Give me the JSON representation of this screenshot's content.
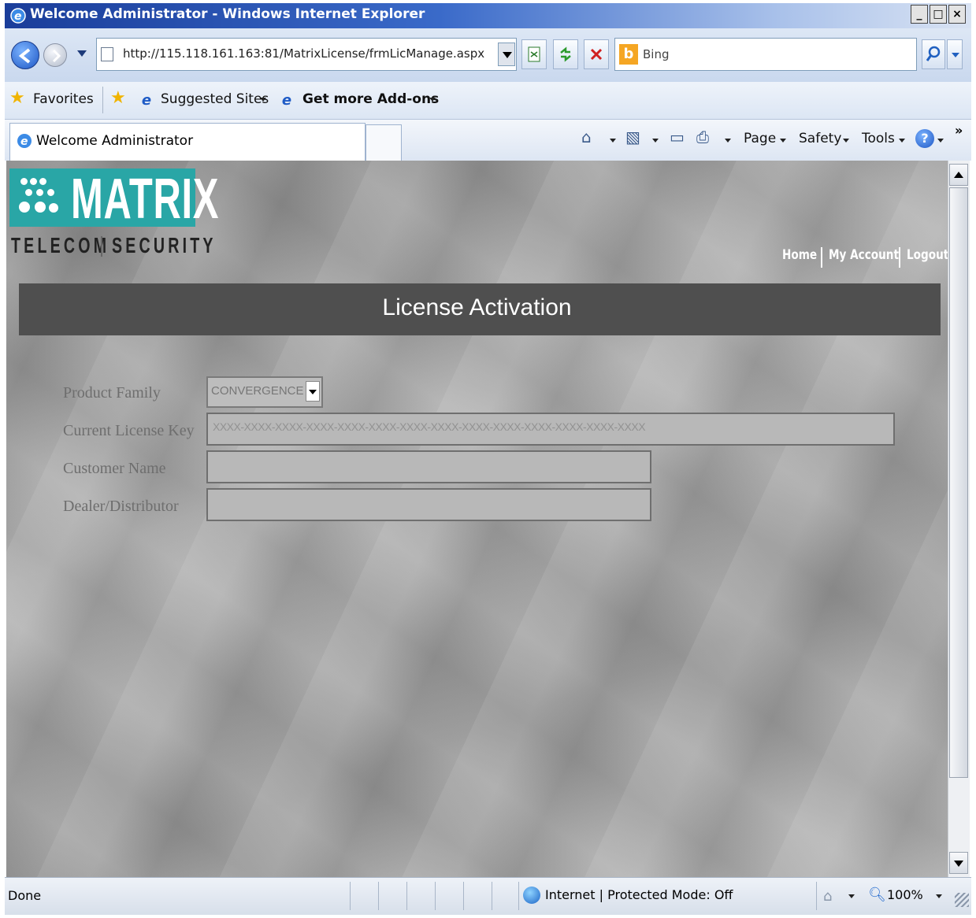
{
  "window": {
    "title": "Welcome Administrator - Windows Internet Explorer",
    "minimize": "_",
    "maximize": "□",
    "close": "×"
  },
  "addressbar": {
    "url": "http://115.118.161.163:81/MatrixLicense/frmLicManage.aspx"
  },
  "search": {
    "provider_icon": "b",
    "placeholder": "Bing",
    "button_glyph": "⚲"
  },
  "favorites_bar": {
    "favorites_label": "Favorites",
    "suggested_sites": "Suggested Sites",
    "get_addons": "Get more Add-ons"
  },
  "tab": {
    "label": "Welcome Administrator"
  },
  "command_bar": {
    "page": "Page",
    "safety": "Safety",
    "tools": "Tools",
    "help": "?",
    "chevron": "»"
  },
  "page": {
    "logo": {
      "name": "MATRIX",
      "sub_left": "TELECOM",
      "sub_right": "SECURITY"
    },
    "nav_links": [
      "Home",
      "My Account",
      "Logout"
    ],
    "header_title": "License Activation",
    "form": {
      "product_family_label": "Product Family",
      "product_family_value": "CONVERGENCE",
      "license_key_label": "Current License Key",
      "license_key_value": "XXXX-XXXX-XXXX-XXXX-XXXX-XXXX-XXXX-XXXX-XXXX-XXXX-XXXX-XXXX-XXXX-XXXX",
      "customer_name_label": "Customer Name",
      "customer_name_value": "",
      "dealer_label": "Dealer/Distributor",
      "dealer_value": ""
    }
  },
  "status_bar": {
    "status": "Done",
    "zone": "Internet | Protected Mode: Off",
    "zoom": "100%"
  },
  "colors": {
    "titlebar": "#1a3d9a",
    "logo_teal": "#29a6a6",
    "header_band": "#4f4f4f"
  }
}
